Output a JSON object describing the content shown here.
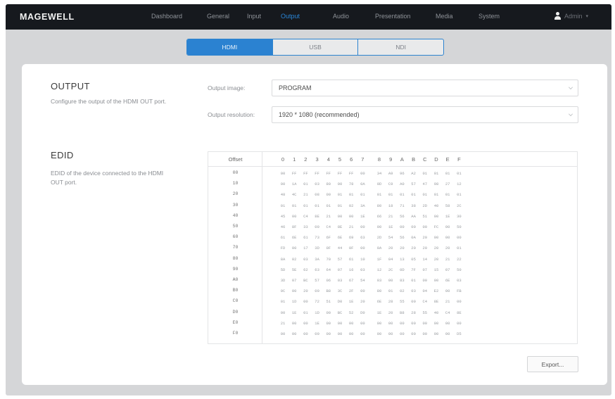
{
  "brand": {
    "logo": "MAGEWELL"
  },
  "nav": {
    "items": [
      {
        "label": "Dashboard"
      },
      {
        "label": "General"
      },
      {
        "label": "Input"
      },
      {
        "label": "Output",
        "active": true
      },
      {
        "label": "Audio"
      },
      {
        "label": "Presentation"
      },
      {
        "label": "Media"
      },
      {
        "label": "System"
      }
    ],
    "user": {
      "name": "Admin",
      "icon": "user-icon"
    },
    "active_color": "#2a86d8"
  },
  "subtabs": [
    {
      "label": "HDMI",
      "active": true
    },
    {
      "label": "USB"
    },
    {
      "label": "NDI"
    }
  ],
  "output_section": {
    "title": "OUTPUT",
    "description": "Configure the output of the HDMI OUT port.",
    "output_image_label": "Output image:",
    "output_image_value": "PROGRAM",
    "output_resolution_label": "Output resolution:",
    "output_resolution_value": "1920 * 1080 (recommended)"
  },
  "edid_section": {
    "title": "EDID",
    "description": "EDID of the device connected to the HDMI OUT port.",
    "offset_header": "Offset",
    "columns": [
      "0",
      "1",
      "2",
      "3",
      "4",
      "5",
      "6",
      "7",
      "8",
      "9",
      "A",
      "B",
      "C",
      "D",
      "E",
      "F"
    ],
    "offsets": [
      "00",
      "10",
      "20",
      "30",
      "40",
      "50",
      "60",
      "70",
      "80",
      "90",
      "A0",
      "B0",
      "C0",
      "D0",
      "E0",
      "F0"
    ],
    "rows": [
      [
        "00",
        "FF",
        "FF",
        "FF",
        "FF",
        "FF",
        "FF",
        "00",
        "34",
        "A9",
        "96",
        "A2",
        "01",
        "01",
        "01",
        "01"
      ],
      [
        "00",
        "1A",
        "01",
        "03",
        "80",
        "00",
        "78",
        "0A",
        "0D",
        "C9",
        "A0",
        "57",
        "47",
        "98",
        "27",
        "12"
      ],
      [
        "48",
        "4C",
        "21",
        "08",
        "00",
        "01",
        "01",
        "01",
        "01",
        "01",
        "01",
        "01",
        "01",
        "01",
        "01",
        "01"
      ],
      [
        "01",
        "01",
        "01",
        "01",
        "01",
        "01",
        "02",
        "3A",
        "80",
        "18",
        "71",
        "38",
        "2D",
        "40",
        "58",
        "2C"
      ],
      [
        "45",
        "00",
        "C4",
        "8E",
        "21",
        "00",
        "00",
        "1E",
        "66",
        "21",
        "56",
        "AA",
        "51",
        "00",
        "1E",
        "30"
      ],
      [
        "46",
        "8F",
        "33",
        "00",
        "C4",
        "8E",
        "21",
        "00",
        "00",
        "1E",
        "00",
        "00",
        "00",
        "FC",
        "00",
        "50"
      ],
      [
        "61",
        "6E",
        "61",
        "73",
        "6F",
        "6E",
        "69",
        "63",
        "2D",
        "54",
        "56",
        "0A",
        "20",
        "00",
        "00",
        "00"
      ],
      [
        "FD",
        "00",
        "17",
        "3D",
        "0F",
        "44",
        "0F",
        "00",
        "0A",
        "20",
        "20",
        "20",
        "20",
        "20",
        "20",
        "01"
      ],
      [
        "8A",
        "02",
        "03",
        "3A",
        "70",
        "57",
        "61",
        "10",
        "1F",
        "04",
        "13",
        "05",
        "14",
        "20",
        "21",
        "22"
      ],
      [
        "5D",
        "5E",
        "62",
        "63",
        "64",
        "07",
        "16",
        "03",
        "12",
        "2C",
        "0D",
        "7F",
        "07",
        "15",
        "07",
        "50"
      ],
      [
        "3D",
        "07",
        "BC",
        "57",
        "06",
        "03",
        "67",
        "54",
        "03",
        "00",
        "83",
        "01",
        "00",
        "00",
        "6E",
        "03"
      ],
      [
        "0C",
        "00",
        "20",
        "00",
        "B8",
        "3C",
        "2F",
        "00",
        "80",
        "01",
        "02",
        "03",
        "04",
        "E2",
        "00",
        "FB"
      ],
      [
        "01",
        "1D",
        "00",
        "72",
        "51",
        "D0",
        "1E",
        "20",
        "6E",
        "28",
        "55",
        "00",
        "C4",
        "8E",
        "21",
        "00"
      ],
      [
        "00",
        "1E",
        "01",
        "1D",
        "00",
        "BC",
        "52",
        "D0",
        "1E",
        "20",
        "B8",
        "28",
        "55",
        "40",
        "C4",
        "8E"
      ],
      [
        "21",
        "00",
        "00",
        "1E",
        "00",
        "00",
        "00",
        "00",
        "00",
        "00",
        "00",
        "00",
        "00",
        "00",
        "00",
        "00"
      ],
      [
        "00",
        "00",
        "00",
        "00",
        "00",
        "00",
        "00",
        "00",
        "00",
        "00",
        "00",
        "00",
        "00",
        "00",
        "00",
        "D5"
      ]
    ]
  },
  "export_button": {
    "label": "Export..."
  }
}
